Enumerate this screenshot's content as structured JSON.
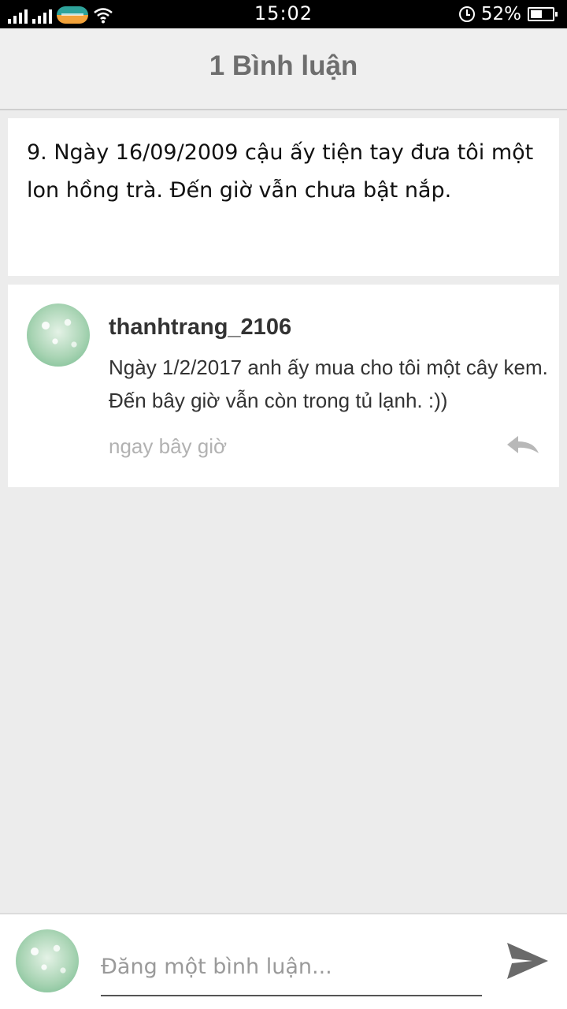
{
  "status_bar": {
    "time": "15:02",
    "battery_percent": "52%",
    "battery_level": 0.52,
    "icons": [
      "signal-icon",
      "signal-icon",
      "carrier-logo-icon",
      "wifi-icon",
      "alarm-icon",
      "battery-icon"
    ]
  },
  "header": {
    "title": "1 Bình luận"
  },
  "post": {
    "text": "9. Ngày 16/09/2009 cậu ấy tiện tay đưa tôi một lon hồng trà. Đến giờ vẫn chưa bật nắp."
  },
  "comments": [
    {
      "author": "thanhtrang_2106",
      "body": "Ngày 1/2/2017 anh ấy mua cho tôi một cây kem. Đến bây giờ vẫn còn trong tủ lạnh. :))",
      "time": "ngay bây giờ",
      "reply_icon": "reply-icon"
    }
  ],
  "composer": {
    "placeholder": "Đăng một bình luận...",
    "value": "",
    "send_icon": "send-icon"
  },
  "colors": {
    "background": "#ececec",
    "card": "#ffffff",
    "header_title": "#6e6e6e",
    "muted": "#b2b2b2"
  }
}
